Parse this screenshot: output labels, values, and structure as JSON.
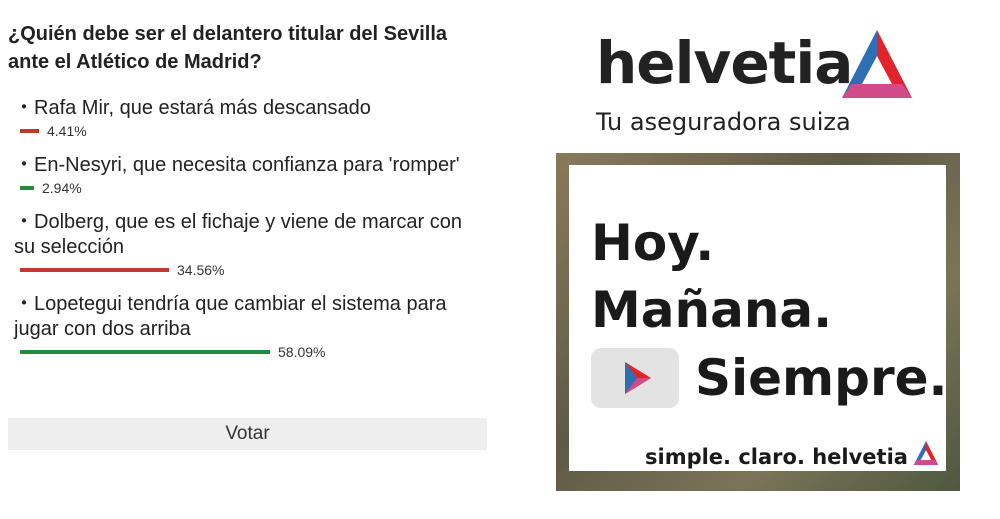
{
  "poll": {
    "question": "¿Quién debe ser el delantero titular del Sevilla ante el Atlético de Madrid?",
    "options": [
      {
        "text": "・Rafa Mir, que estará más descansado",
        "percent_label": "4.41%",
        "percent": 4.41,
        "color": "#c0392b"
      },
      {
        "text": "・En-Nesyri, que necesita confianza para 'romper'",
        "percent_label": "2.94%",
        "percent": 2.94,
        "color": "#1e8c3a"
      },
      {
        "text": "・Dolberg, que es el fichaje y viene de marcar con su selección",
        "percent_label": "34.56%",
        "percent": 34.56,
        "color": "#c0392b"
      },
      {
        "text": "・Lopetegui tendría que cambiar el sistema para jugar con dos arriba",
        "percent_label": "58.09%",
        "percent": 58.09,
        "color": "#1e8c3a"
      }
    ],
    "vote_label": "Votar"
  },
  "ad": {
    "brand": "helvetia",
    "tagline": "Tu aseguradora suiza",
    "headline_1": "Hoy.",
    "headline_2": "Mañana.",
    "headline_3": "Siempre.",
    "footer": "simple. claro. helvetia",
    "play_icon": "play-icon",
    "logo_icon": "helvetia-logo-icon",
    "brand_colors": {
      "red": "#e3232b",
      "blue": "#2d6fb5",
      "pink": "#d14a8a"
    }
  }
}
